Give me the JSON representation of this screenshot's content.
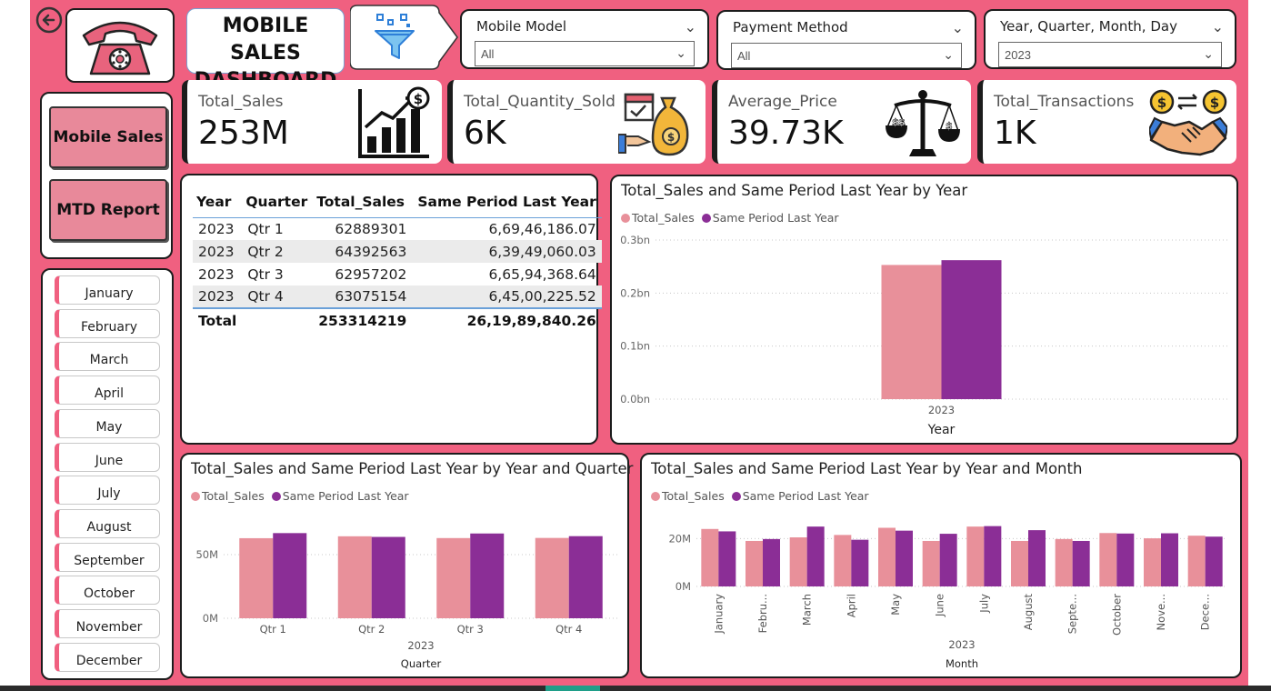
{
  "dashboard": {
    "title": "MOBILE SALES DASHBOARD",
    "colors": {
      "background": "#f06080",
      "total_sales": "#e8909a",
      "same_period": "#8b2e96",
      "accent_blue": "#6aa0d8"
    }
  },
  "icons": {
    "back": "back-arrow-icon",
    "logo": "telephone-icon",
    "filter": "filter-funnel-icon",
    "sales": "bar-chart-growth-icon",
    "quantity": "calendar-money-bag-icon",
    "price": "scales-icon",
    "transactions": "handshake-exchange-icon"
  },
  "slicers": [
    {
      "label": "Mobile Model",
      "value": "All"
    },
    {
      "label": "Payment Method",
      "value": "All"
    },
    {
      "label": "Year, Quarter, Month, Day",
      "value": "2023"
    }
  ],
  "kpis": [
    {
      "label": "Total_Sales",
      "value": "253M"
    },
    {
      "label": "Total_Quantity_Sold",
      "value": "6K"
    },
    {
      "label": "Average_Price",
      "value": "39.73K"
    },
    {
      "label": "Total_Transactions",
      "value": "1K"
    }
  ],
  "nav": {
    "mobile_sales": "Mobile Sales",
    "mtd_report": "MTD Report"
  },
  "months": [
    "January",
    "February",
    "March",
    "April",
    "May",
    "June",
    "July",
    "August",
    "September",
    "October",
    "November",
    "December"
  ],
  "matrix": {
    "headers": [
      "Year",
      "Quarter",
      "Total_Sales",
      "Same Period Last Year"
    ],
    "rows": [
      [
        "2023",
        "Qtr 1",
        "62889301",
        "6,69,46,186.07"
      ],
      [
        "2023",
        "Qtr 2",
        "64392563",
        "6,39,49,060.03"
      ],
      [
        "2023",
        "Qtr 3",
        "62957202",
        "6,65,94,368.64"
      ],
      [
        "2023",
        "Qtr 4",
        "63075154",
        "6,45,00,225.52"
      ]
    ],
    "total": [
      "Total",
      "",
      "253314219",
      "26,19,89,840.26"
    ]
  },
  "legend": {
    "total_sales": "Total_Sales",
    "same_period": "Same Period Last Year"
  },
  "chart_data": [
    {
      "type": "bar",
      "title": "Total_Sales and Same Period Last Year by Year",
      "categories": [
        "2023"
      ],
      "series": [
        {
          "name": "Total_Sales",
          "values": [
            0.253
          ]
        },
        {
          "name": "Same Period Last Year",
          "values": [
            0.262
          ]
        }
      ],
      "xlabel": "Year",
      "ylabel": "",
      "ylim": [
        0,
        0.3
      ],
      "yticks": [
        "0.0bn",
        "0.1bn",
        "0.2bn",
        "0.3bn"
      ],
      "legend": "top-left",
      "grid": true
    },
    {
      "type": "bar",
      "title": "Total_Sales and Same Period Last Year by Year and Quarter",
      "categories": [
        "Qtr 1",
        "Qtr 2",
        "Qtr 3",
        "Qtr 4"
      ],
      "group_label": "2023",
      "series": [
        {
          "name": "Total_Sales",
          "values": [
            62.9,
            64.4,
            63.0,
            63.1
          ]
        },
        {
          "name": "Same Period Last Year",
          "values": [
            66.9,
            63.9,
            66.6,
            64.5
          ]
        }
      ],
      "xlabel": "Quarter",
      "ylabel": "",
      "ylim": [
        0,
        80
      ],
      "yticks": [
        "0M",
        "50M"
      ],
      "legend": "top-left",
      "grid": true
    },
    {
      "type": "bar",
      "title": "Total_Sales and Same Period Last Year by Year and Month",
      "categories": [
        "January",
        "Febru...",
        "March",
        "April",
        "May",
        "June",
        "July",
        "August",
        "Septe...",
        "October",
        "Nove...",
        "Dece..."
      ],
      "group_label": "2023",
      "series": [
        {
          "name": "Total_Sales",
          "values": [
            24.0,
            19.0,
            20.5,
            21.5,
            24.5,
            19.0,
            25.0,
            19.0,
            19.8,
            22.3,
            20.1,
            21.2
          ]
        },
        {
          "name": "Same Period Last Year",
          "values": [
            23.0,
            19.8,
            25.0,
            19.5,
            23.3,
            22.0,
            25.2,
            23.5,
            19.0,
            22.1,
            22.2,
            20.8
          ]
        }
      ],
      "xlabel": "Month",
      "ylabel": "",
      "ylim": [
        0,
        30
      ],
      "yticks": [
        "0M",
        "20M"
      ],
      "legend": "top-left",
      "grid": true
    }
  ]
}
